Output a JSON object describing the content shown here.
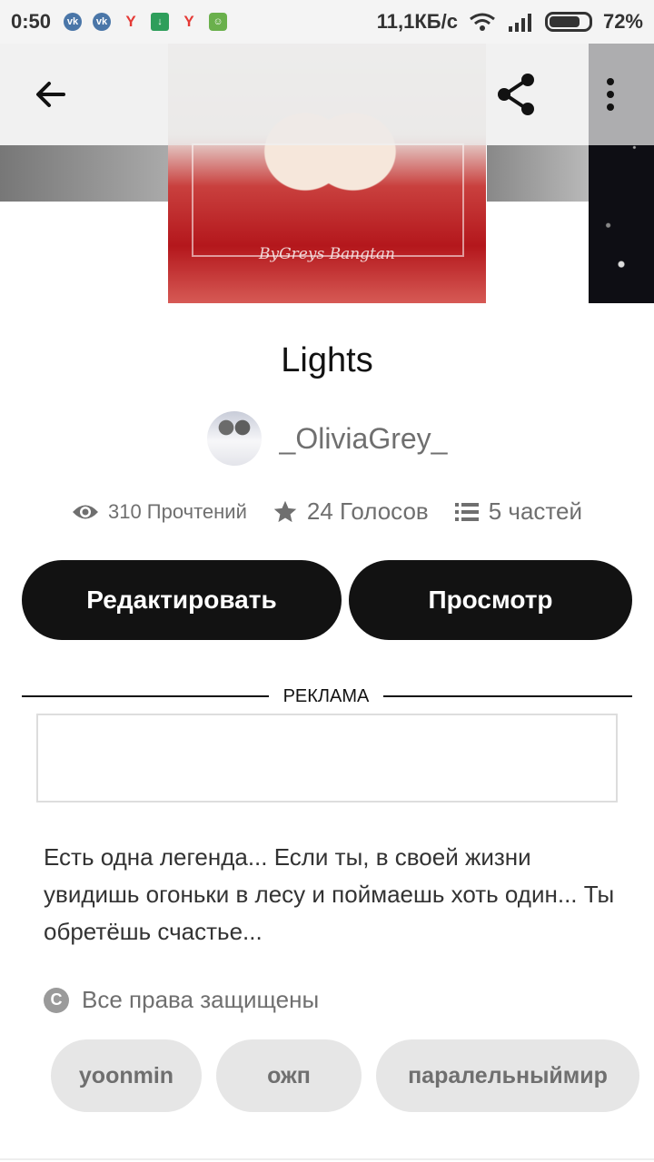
{
  "status_bar": {
    "time": "0:50",
    "network_speed": "11,1КБ/с",
    "battery": "72%",
    "notification_icons": [
      "vk-icon",
      "vk-icon",
      "yandex-icon",
      "download-icon",
      "yandex-icon",
      "android-icon"
    ]
  },
  "toolbar": {
    "back_icon": "arrow-left-icon",
    "share_icon": "share-icon",
    "more_icon": "more-vertical-icon"
  },
  "cover": {
    "signature": "ByGreys Bangtan"
  },
  "story": {
    "title": "Lights",
    "author": "_OliviaGrey_",
    "reads": "310 Прочтений",
    "votes": "24 Голосов",
    "parts": "5 частей",
    "description": "Есть одна легенда... Если ты, в своей жизни увидишь огоньки в лесу и поймаешь хоть один... Ты обретёшь счастье...",
    "rights": "Все права защищены"
  },
  "actions": {
    "edit_label": "Редактировать",
    "view_label": "Просмотр"
  },
  "ad": {
    "label": "РЕКЛАМА"
  },
  "tags": [
    "yoonmin",
    "ожп",
    "паралельныймир"
  ]
}
